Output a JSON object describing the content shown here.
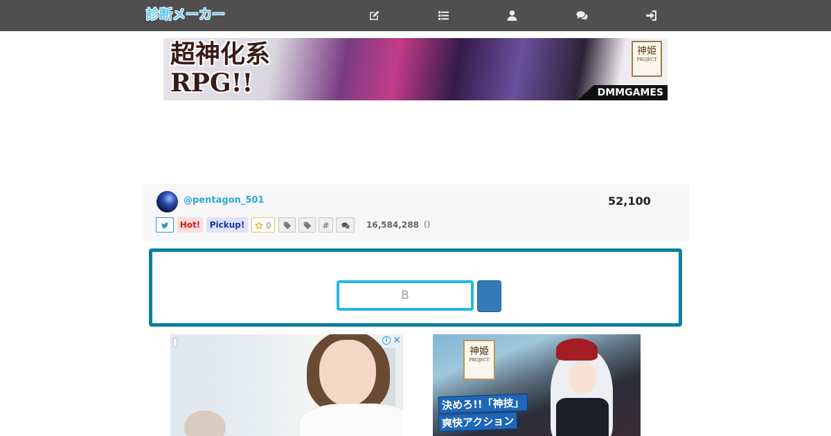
{
  "header": {
    "logo": "診断メーカー",
    "nav": [
      {
        "icon": "edit-icon"
      },
      {
        "icon": "list-icon"
      },
      {
        "icon": "user-icon"
      },
      {
        "icon": "comments-icon"
      },
      {
        "icon": "sign-in-icon"
      }
    ],
    "background": "#4f4f4f",
    "logo_color": "#5fc8f0"
  },
  "banner_ad": {
    "headline": "超神化系\nRPG!!",
    "seal": "神姫",
    "seal_sub": "PROJECT",
    "brand": "DMMGAMES"
  },
  "diagnosis": {
    "author": "@pentagon_501",
    "count": "52,100",
    "badges": {
      "hot": "Hot!",
      "pickup": "Pickup!",
      "favorites": "0",
      "hash": "#"
    },
    "views": "16,584,288",
    "views_paren": "()"
  },
  "form": {
    "input_value": "B",
    "border_color": "#0e7fa0",
    "input_border_color": "#22b6e8",
    "button_color": "#337ab7"
  },
  "bottom_ads": {
    "left": {
      "info_icon": "info-icon",
      "close_icon": "close-icon",
      "close": "✕",
      "info": "i"
    },
    "right": {
      "seal": "神姫",
      "seal_sub": "PROJECT",
      "caption1": "決めろ!!「神技」",
      "caption2": "爽快アクション"
    }
  }
}
